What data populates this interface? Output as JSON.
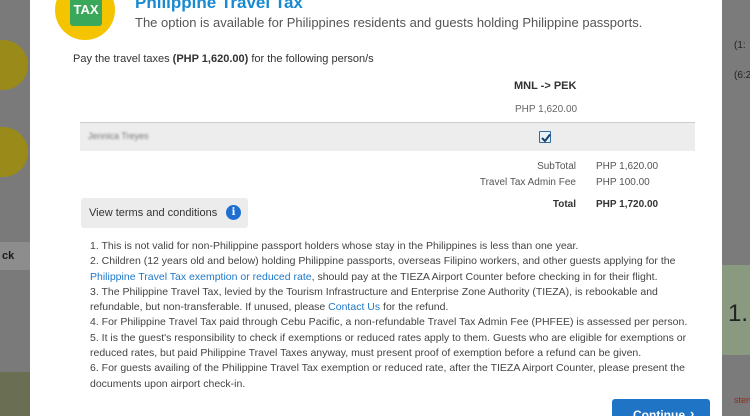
{
  "modal": {
    "logo_text": "TAX",
    "title": "Philippine Travel Tax",
    "subtitle": "The option is available for Philippines residents and guests holding Philippine passports.",
    "pay_prefix": "Pay the travel taxes ",
    "pay_amount": "(PHP 1,620.00)",
    "pay_suffix": " for the following person/s",
    "route": "MNL -> PEK",
    "route_amount": "PHP 1,620.00",
    "passenger_name": "Jennica Treyes",
    "passenger_checked": true,
    "subtotal_label": "SubTotal",
    "subtotal_value": "PHP 1,620.00",
    "admin_fee_label": "Travel Tax Admin Fee",
    "admin_fee_value": "PHP 100.00",
    "total_label": "Total",
    "total_value": "PHP 1,720.00",
    "terms_button": "View terms and conditions",
    "info_icon": "i",
    "terms": {
      "t1": "1. This is not valid for non-Philippine passport holders whose stay in the Philippines is less than one year.",
      "t2a": "2. Children (12 years old and below) holding Philippine passports, overseas Filipino workers, and other guests applying for the ",
      "t2_link": "Philippine Travel Tax exemption or reduced rate",
      "t2b": ", should pay at the TIEZA Airport Counter before checking in for their flight.",
      "t3a": "3. The Philippine Travel Tax, levied by the Tourism Infrastructure and Enterprise Zone Authority (TIEZA), is rebookable and refundable, but non-transferable. If unused, please ",
      "t3_link": "Contact Us",
      "t3b": " for the refund.",
      "t4": "4. For Philippine Travel Tax paid through Cebu Pacific, a non-refundable Travel Tax Admin Fee (PHFEE) is assessed per person.",
      "t5": "5. It is the guest's responsibility to check if exemptions or reduced rates apply to them. Guests who are eligible for exemptions or reduced rates, but paid Philippine Travel Taxes anyway, must present proof of exemption before a refund can be given.",
      "t6": "6. For guests availing of the Philippine Travel Tax exemption or reduced rate, after the TIEZA Airport Counter, please present the documents upon airport check-in."
    },
    "continue_label": "Continue",
    "continue_icon": "›"
  },
  "background": {
    "left_label": "ck",
    "right_text_1": "(1:",
    "right_text_2": "(6:2",
    "right_big": "1.",
    "right_small": "sterC"
  },
  "colors": {
    "title": "#1a8ad0",
    "button": "#1f74c6",
    "link": "#1e78c8",
    "logo": "#f4c400",
    "tax_bag": "#3aa85a"
  }
}
